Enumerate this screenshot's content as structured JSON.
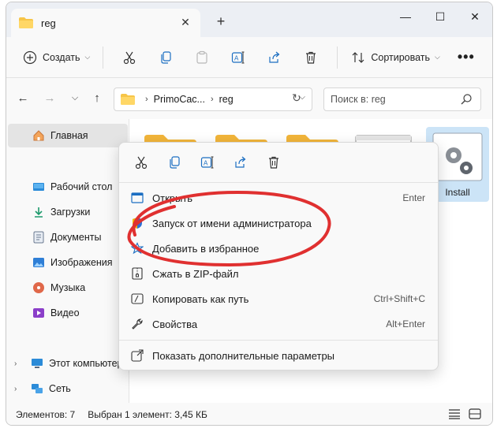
{
  "colors": {
    "accent": "#0067c0",
    "folder": "#f7c548",
    "highlight_oval": "#e03030"
  },
  "tab": {
    "title": "reg",
    "close_icon": "close-icon"
  },
  "window_controls": [
    "minimize",
    "maximize",
    "close"
  ],
  "toolbar": {
    "new_label": "Создать",
    "sort_label": "Сортировать",
    "more_label": "•••"
  },
  "address": {
    "crumbs": [
      "PrimoCac...",
      "reg"
    ],
    "search_placeholder": "Поиск в: reg"
  },
  "sidebar": {
    "items": [
      {
        "label": "Главная",
        "icon": "home-icon"
      },
      {
        "label": "Рабочий стол",
        "icon": "desktop-icon"
      },
      {
        "label": "Загрузки",
        "icon": "downloads-icon"
      },
      {
        "label": "Документы",
        "icon": "documents-icon"
      },
      {
        "label": "Изображения",
        "icon": "pictures-icon"
      },
      {
        "label": "Музыка",
        "icon": "music-icon"
      },
      {
        "label": "Видео",
        "icon": "video-icon"
      },
      {
        "label": "Этот компьютер",
        "icon": "pc-icon"
      },
      {
        "label": "Сеть",
        "icon": "network-icon"
      }
    ]
  },
  "files": {
    "selected_label": "Install"
  },
  "context_menu": {
    "items": [
      {
        "label": "Открыть",
        "shortcut": "Enter"
      },
      {
        "label": "Запуск от имени администратора",
        "shortcut": ""
      },
      {
        "label": "Добавить в избранное",
        "shortcut": ""
      },
      {
        "label": "Сжать в ZIP-файл",
        "shortcut": ""
      },
      {
        "label": "Копировать как путь",
        "shortcut": "Ctrl+Shift+C"
      },
      {
        "label": "Свойства",
        "shortcut": "Alt+Enter"
      },
      {
        "label": "Показать дополнительные параметры",
        "shortcut": ""
      }
    ]
  },
  "status": {
    "count": "Элементов: 7",
    "selection": "Выбран 1 элемент: 3,45 КБ"
  }
}
